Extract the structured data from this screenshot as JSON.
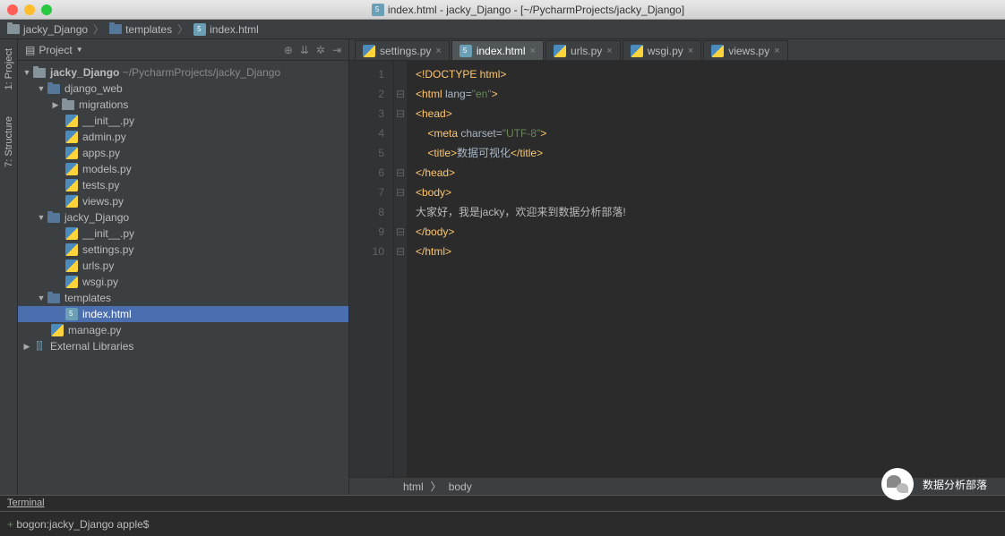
{
  "window": {
    "title": "index.html - jacky_Django - [~/PycharmProjects/jacky_Django]"
  },
  "breadcrumb": {
    "items": [
      "jacky_Django",
      "templates",
      "index.html"
    ]
  },
  "left_tabs": {
    "project": "1: Project",
    "structure": "7: Structure"
  },
  "sidebar": {
    "title": "Project",
    "root": {
      "name": "jacky_Django",
      "path": "~/PycharmProjects/jacky_Django"
    },
    "django_web": "django_web",
    "migrations": "migrations",
    "files_web": [
      "__init__.py",
      "admin.py",
      "apps.py",
      "models.py",
      "tests.py",
      "views.py"
    ],
    "pkg": "jacky_Django",
    "files_pkg": [
      "__init__.py",
      "settings.py",
      "urls.py",
      "wsgi.py"
    ],
    "templates": "templates",
    "index": "index.html",
    "manage": "manage.py",
    "external": "External Libraries"
  },
  "tabs": [
    "settings.py",
    "index.html",
    "urls.py",
    "wsgi.py",
    "views.py"
  ],
  "active_tab": 1,
  "code": {
    "lines": [
      1,
      2,
      3,
      4,
      5,
      6,
      7,
      8,
      9,
      10
    ],
    "doctype": "<!DOCTYPE html>",
    "html_open_a": "<html ",
    "lang_attr": "lang=",
    "lang_val": "\"en\"",
    "gt": ">",
    "head_open": "<head>",
    "meta_a": "    <meta ",
    "charset_attr": "charset=",
    "charset_val": "\"UTF-8\"",
    "title_open": "    <title>",
    "title_text": "数据可视化",
    "title_close": "</title>",
    "head_close": "</head>",
    "body_open": "<body>",
    "body_text": "大家好，我是jacky，欢迎来到数据分析部落!",
    "body_close": "</body>",
    "html_close": "</html>"
  },
  "editor_breadcrumb": {
    "a": "html",
    "b": "body"
  },
  "terminal": {
    "tab": "Terminal",
    "prompt": "bogon:jacky_Django apple$"
  },
  "watermark": "数据分析部落"
}
